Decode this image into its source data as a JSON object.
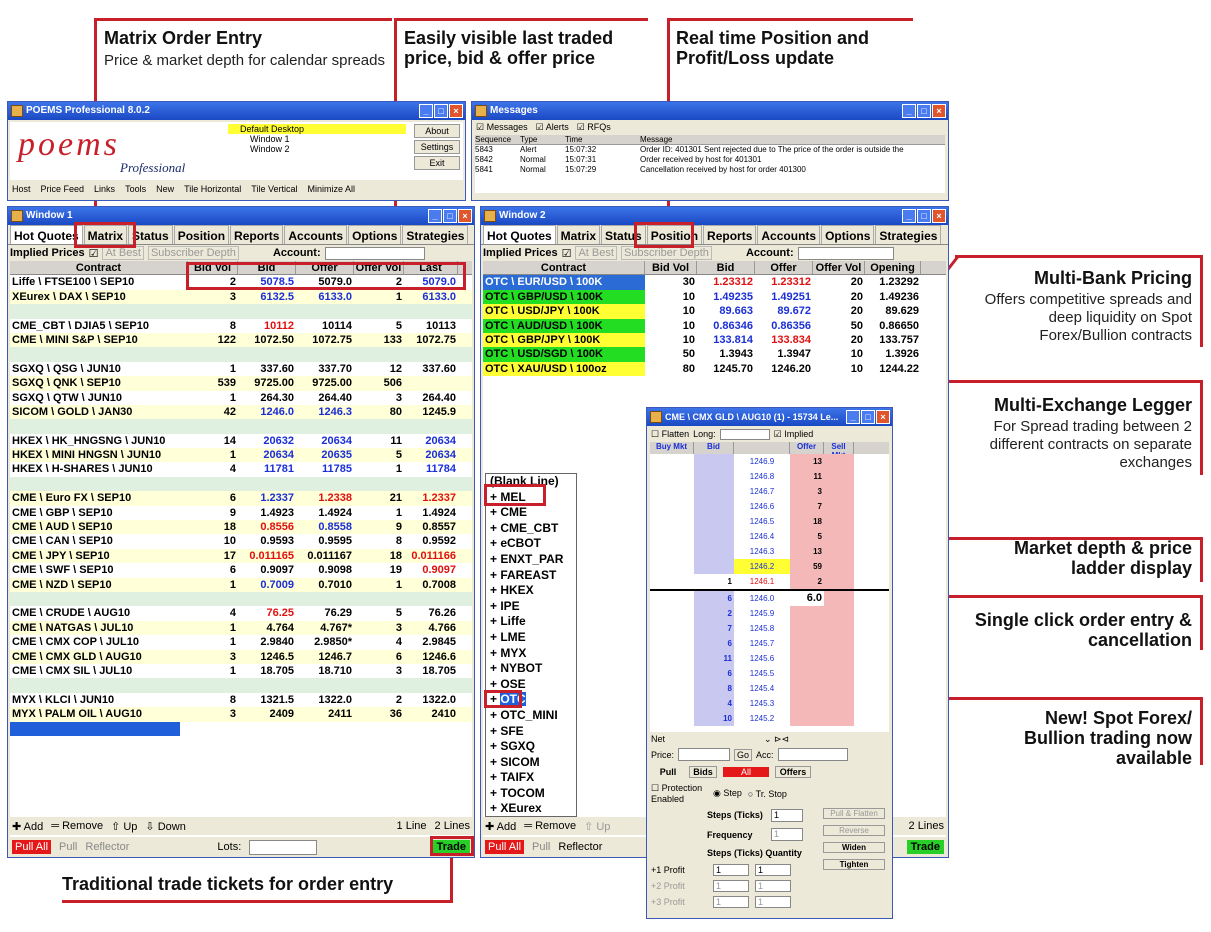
{
  "annotations": {
    "matrix_title": "Matrix Order Entry",
    "matrix_sub": "Price & market depth for calendar spreads",
    "last_traded": "Easily visible last traded price, bid & offer price",
    "realtime": "Real time Position and Profit/Loss update",
    "multibank_title": "Multi-Bank Pricing",
    "multibank_sub": "Offers competitive spreads and deep liquidity on Spot Forex/Bullion contracts",
    "legger_title": "Multi-Exchange Legger",
    "legger_sub": "For Spread trading between 2 different contracts on separate exchanges",
    "depth": "Market depth & price ladder display",
    "single_click": "Single click order entry & cancellation",
    "spot": "New! Spot Forex/ Bullion trading now available",
    "tickets": "Traditional trade tickets for order entry"
  },
  "main_window": {
    "title": "POEMS Professional 8.0.2",
    "logo": "poems",
    "logo_sub": "Professional",
    "desktops": [
      "Default Desktop",
      "Window 1",
      "Window 2"
    ],
    "buttons": [
      "About",
      "Settings",
      "Exit"
    ],
    "toolbar": [
      "Host",
      "Price Feed",
      "Links",
      "Tools",
      "New",
      "Tile Horizontal",
      "Tile Vertical",
      "Minimize All"
    ]
  },
  "messages": {
    "title": "Messages",
    "filters": [
      "Messages",
      "Alerts",
      "RFQs"
    ],
    "headers": [
      "Sequence",
      "Type",
      "Time",
      "Message"
    ],
    "rows": [
      [
        "5843",
        "Alert",
        "15:07:32",
        "Order ID: 401301 Sent rejected due to The price of the order is outside the"
      ],
      [
        "5842",
        "Normal",
        "15:07:31",
        "Order received by host for 401301"
      ],
      [
        "5841",
        "Normal",
        "15:07:29",
        "Cancellation received by host for order 401300"
      ]
    ]
  },
  "window1": {
    "title": "Window 1",
    "tabs": [
      "Hot Quotes",
      "Matrix",
      "Status",
      "Position",
      "Reports",
      "Accounts",
      "Options",
      "Strategies"
    ],
    "implied": "Implied Prices",
    "at_best": "At Best",
    "subscriber": "Subscriber Depth",
    "account": "Account:",
    "headers": [
      "Contract",
      "Bid Vol",
      "Bid",
      "Offer",
      "Offer Vol",
      "Last"
    ],
    "rows": [
      {
        "c": "Liffe \\ FTSE100 \\ SEP10",
        "bv": "2",
        "b": "5078.5",
        "o": "5079.0",
        "ov": "2",
        "l": "5079.0",
        "s": "w",
        "bc": "blue",
        "lc": "blue"
      },
      {
        "c": "XEurex \\ DAX \\ SEP10",
        "bv": "3",
        "b": "6132.5",
        "o": "6133.0",
        "ov": "1",
        "l": "6133.0",
        "s": "y",
        "bc": "blue",
        "oc": "blue",
        "lc": "blue"
      },
      {
        "c": "",
        "s": "g"
      },
      {
        "c": "CME_CBT \\ DJIA5 \\ SEP10",
        "bv": "8",
        "b": "10112",
        "o": "10114",
        "ov": "5",
        "l": "10113",
        "s": "w",
        "bc": "red"
      },
      {
        "c": "CME \\ MINI S&P \\ SEP10",
        "bv": "122",
        "b": "1072.50",
        "o": "1072.75",
        "ov": "133",
        "l": "1072.75",
        "s": "y"
      },
      {
        "c": "",
        "s": "g"
      },
      {
        "c": "SGXQ \\ QSG \\ JUN10",
        "bv": "1",
        "b": "337.60",
        "o": "337.70",
        "ov": "12",
        "l": "337.60",
        "s": "w"
      },
      {
        "c": "SGXQ \\ QNK \\ SEP10",
        "bv": "539",
        "b": "9725.00",
        "o": "9725.00",
        "ov": "506",
        "l": "",
        "s": "y"
      },
      {
        "c": "SGXQ \\ QTW \\ JUN10",
        "bv": "1",
        "b": "264.30",
        "o": "264.40",
        "ov": "3",
        "l": "264.40",
        "s": "w"
      },
      {
        "c": "SICOM \\ GOLD \\ JAN30",
        "bv": "42",
        "b": "1246.0",
        "o": "1246.3",
        "ov": "80",
        "l": "1245.9",
        "s": "y",
        "bc": "blue",
        "oc": "blue"
      },
      {
        "c": "",
        "s": "g"
      },
      {
        "c": "HKEX \\ HK_HNGSNG \\ JUN10",
        "bv": "14",
        "b": "20632",
        "o": "20634",
        "ov": "11",
        "l": "20634",
        "s": "w",
        "bc": "blue",
        "oc": "blue",
        "lc": "blue"
      },
      {
        "c": "HKEX \\ MINI HNGSN \\ JUN10",
        "bv": "1",
        "b": "20634",
        "o": "20635",
        "ov": "5",
        "l": "20634",
        "s": "y",
        "bc": "blue",
        "oc": "blue",
        "lc": "blue"
      },
      {
        "c": "HKEX \\ H-SHARES \\ JUN10",
        "bv": "4",
        "b": "11781",
        "o": "11785",
        "ov": "1",
        "l": "11784",
        "s": "w",
        "bc": "blue",
        "oc": "blue",
        "lc": "blue"
      },
      {
        "c": "",
        "s": "g"
      },
      {
        "c": "CME \\ Euro FX \\ SEP10",
        "bv": "6",
        "b": "1.2337",
        "o": "1.2338",
        "ov": "21",
        "l": "1.2337",
        "s": "y",
        "bc": "blue",
        "oc": "red",
        "lc": "red"
      },
      {
        "c": "CME \\ GBP \\ SEP10",
        "bv": "9",
        "b": "1.4923",
        "o": "1.4924",
        "ov": "1",
        "l": "1.4924",
        "s": "w"
      },
      {
        "c": "CME \\ AUD \\ SEP10",
        "bv": "18",
        "b": "0.8556",
        "o": "0.8558",
        "ov": "9",
        "l": "0.8557",
        "s": "y",
        "bc": "red",
        "oc": "blue"
      },
      {
        "c": "CME \\ CAN \\ SEP10",
        "bv": "10",
        "b": "0.9593",
        "o": "0.9595",
        "ov": "8",
        "l": "0.9592",
        "s": "w"
      },
      {
        "c": "CME \\ JPY \\ SEP10",
        "bv": "17",
        "b": "0.011165",
        "o": "0.011167",
        "ov": "18",
        "l": "0.011166",
        "s": "y",
        "bc": "red",
        "lc": "red"
      },
      {
        "c": "CME \\ SWF \\ SEP10",
        "bv": "6",
        "b": "0.9097",
        "o": "0.9098",
        "ov": "19",
        "l": "0.9097",
        "s": "w",
        "lc": "red"
      },
      {
        "c": "CME \\ NZD \\ SEP10",
        "bv": "1",
        "b": "0.7009",
        "o": "0.7010",
        "ov": "1",
        "l": "0.7008",
        "s": "y",
        "bc": "blue"
      },
      {
        "c": "",
        "s": "g"
      },
      {
        "c": "CME \\ CRUDE \\ AUG10",
        "bv": "4",
        "b": "76.25",
        "o": "76.29",
        "ov": "5",
        "l": "76.26",
        "s": "w",
        "bc": "red"
      },
      {
        "c": "CME \\ NATGAS \\ JUL10",
        "bv": "1",
        "b": "4.764",
        "o": "4.767*",
        "ov": "3",
        "l": "4.766",
        "s": "y"
      },
      {
        "c": "CME \\ CMX COP \\ JUL10",
        "bv": "1",
        "b": "2.9840",
        "o": "2.9850*",
        "ov": "4",
        "l": "2.9845",
        "s": "w"
      },
      {
        "c": "CME \\ CMX GLD \\ AUG10",
        "bv": "3",
        "b": "1246.5",
        "o": "1246.7",
        "ov": "6",
        "l": "1246.6",
        "s": "y"
      },
      {
        "c": "CME \\ CMX SIL \\ JUL10",
        "bv": "1",
        "b": "18.705",
        "o": "18.710",
        "ov": "3",
        "l": "18.705",
        "s": "w"
      },
      {
        "c": "",
        "s": "g"
      },
      {
        "c": "MYX \\ KLCI \\ JUN10",
        "bv": "8",
        "b": "1321.5",
        "o": "1322.0",
        "ov": "2",
        "l": "1322.0",
        "s": "w"
      },
      {
        "c": "MYX \\ PALM OIL \\ AUG10",
        "bv": "3",
        "b": "2409",
        "o": "2411",
        "ov": "36",
        "l": "2410",
        "s": "y"
      }
    ],
    "bottom1": [
      "Add",
      "Remove",
      "Up",
      "Down",
      "1 Line",
      "2 Lines"
    ],
    "bottom2": [
      "Pull All",
      "Pull",
      "Reflector",
      "Lots:",
      "Trade"
    ]
  },
  "window2": {
    "title": "Window 2",
    "tabs": [
      "Hot Quotes",
      "Matrix",
      "Status",
      "Position",
      "Reports",
      "Accounts",
      "Options",
      "Strategies"
    ],
    "headers": [
      "Contract",
      "Bid Vol",
      "Bid",
      "Offer",
      "Offer Vol",
      "Opening"
    ],
    "rows": [
      {
        "c": "OTC \\ EUR/USD \\ 100K",
        "bv": "30",
        "b": "1.23312",
        "o": "1.23312",
        "ov": "20",
        "op": "1.23292",
        "cc": "#2b6bd6",
        "bc": "red",
        "oc": "red"
      },
      {
        "c": "OTC \\ GBP/USD \\ 100K",
        "bv": "10",
        "b": "1.49235",
        "o": "1.49251",
        "ov": "20",
        "op": "1.49236",
        "cc": "#22dd22",
        "bc": "blue",
        "oc": "blue"
      },
      {
        "c": "OTC \\ USD/JPY \\ 100K",
        "bv": "10",
        "b": "89.663",
        "o": "89.672",
        "ov": "20",
        "op": "89.629",
        "cc": "#ffff33",
        "bc": "blue",
        "oc": "blue"
      },
      {
        "c": "OTC \\ AUD/USD \\ 100K",
        "bv": "10",
        "b": "0.86346",
        "o": "0.86356",
        "ov": "50",
        "op": "0.86650",
        "cc": "#22dd22",
        "bc": "blue",
        "oc": "blue"
      },
      {
        "c": "OTC \\ GBP/JPY \\ 100K",
        "bv": "10",
        "b": "133.814",
        "o": "133.834",
        "ov": "20",
        "op": "133.757",
        "cc": "#ffff33",
        "bc": "blue",
        "oc": "red"
      },
      {
        "c": "OTC \\ USD/SGD \\ 100K",
        "bv": "50",
        "b": "1.3943",
        "o": "1.3947",
        "ov": "10",
        "op": "1.3926",
        "cc": "#22dd22"
      },
      {
        "c": "OTC \\ XAU/USD \\ 100oz",
        "bv": "80",
        "b": "1245.70",
        "o": "1246.20",
        "ov": "10",
        "op": "1244.22",
        "cc": "#ffff33"
      }
    ],
    "bottom1": [
      "Add",
      "Remove",
      "Up",
      "2 Lines"
    ],
    "bottom2": [
      "Pull All",
      "Pull",
      "Reflector",
      "Trade"
    ]
  },
  "exchanges": [
    "(Blank Line)",
    "MEL",
    "CME",
    "CME_CBT",
    "eCBOT",
    "ENXT_PAR",
    "FAREAST",
    "HKEX",
    "IPE",
    "Liffe",
    "LME",
    "MYX",
    "NYBOT",
    "OSE",
    "OTC",
    "OTC_MINI",
    "SFE",
    "SGXQ",
    "SICOM",
    "TAIFX",
    "TOCOM",
    "XEurex"
  ],
  "ladder_win": {
    "title": "CME \\ CMX GLD \\ AUG10 (1) - 15734 Le...",
    "flatten": "Flatten",
    "long": "Long:",
    "implied": "Implied",
    "headers": [
      "Buy Mkt",
      "Bid",
      "",
      "Offer",
      "Sell Mkt"
    ],
    "asks": [
      [
        "1246.9",
        "13"
      ],
      [
        "1246.8",
        "11"
      ],
      [
        "1246.7",
        "3"
      ],
      [
        "1246.6",
        "7"
      ],
      [
        "1246.5",
        "18"
      ],
      [
        "1246.4",
        "5"
      ],
      [
        "1246.3",
        "13"
      ],
      [
        "1246.2",
        "59"
      ],
      [
        "1246.1",
        "2"
      ]
    ],
    "bids": [
      [
        "6",
        "1246.0"
      ],
      [
        "2",
        "1245.9"
      ],
      [
        "7",
        "1245.8"
      ],
      [
        "6",
        "1245.7"
      ],
      [
        "11",
        "1245.6"
      ],
      [
        "6",
        "1245.5"
      ],
      [
        "8",
        "1245.4"
      ],
      [
        "4",
        "1245.3"
      ],
      [
        "10",
        "1245.2"
      ]
    ],
    "last_vol": "1",
    "depth_val": "6.0",
    "net": "Net",
    "price": "Price:",
    "go": "Go",
    "acc": "Acc:",
    "pull": "Pull",
    "bids_btn": "Bids",
    "all": "All",
    "offers": "Offers",
    "protection": "Protection Enabled",
    "step": "Step",
    "tr_stop": "Tr. Stop",
    "steps_ticks": "Steps (Ticks)",
    "frequency": "Frequency",
    "steps_qty": "Steps (Ticks)  Quantity",
    "profits": [
      "+1 Profit",
      "+2 Profit",
      "+3 Profit"
    ],
    "side_btns": [
      "Pull & Flatten",
      "Reverse",
      "Widen",
      "Tighten"
    ],
    "one": "1"
  }
}
